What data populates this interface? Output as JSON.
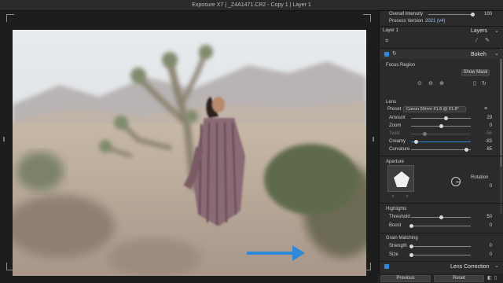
{
  "window": {
    "title": "Exposure X7 | _Z4A1471.CR2 - Copy 1 | Layer 1"
  },
  "panel": {
    "top": {
      "overall_intensity_label": "Overall Intensity",
      "overall_intensity_value": "100",
      "overall_intensity_level": 1.0,
      "process_version_label": "Process Version",
      "process_version_value": "2021 (v4)"
    },
    "layer_label": "Layer 1",
    "layers_label": "Layers",
    "bokeh": {
      "title": "Bokeh",
      "focus_region_label": "Focus Region",
      "show_mask_label": "Show Mask",
      "lens_label": "Lens",
      "preset_label": "Preset:",
      "preset_value": "Canon 50mm f/1.8 @ f/1.8*",
      "sliders": [
        {
          "label": "Amount",
          "value": "29",
          "level": 0.58,
          "dim": false
        },
        {
          "label": "Zoom",
          "value": "0",
          "level": 0.5,
          "dim": false
        },
        {
          "label": "Twist",
          "value": "-56",
          "level": 0.22,
          "dim": true
        },
        {
          "label": "Creamy",
          "value": "-83",
          "level": 0.08,
          "dim": false,
          "accent": true
        },
        {
          "label": "Curvature",
          "value": "85",
          "level": 0.92,
          "dim": false
        }
      ],
      "aperture_label": "Aperture",
      "rotation_label": "Rotation",
      "rotation_value": "0",
      "highlights_label": "Highlights",
      "highlight_sliders": [
        {
          "label": "Threshold",
          "value": "50",
          "level": 0.5
        },
        {
          "label": "Boost",
          "value": "0",
          "level": 0.0
        }
      ],
      "grain_label": "Grain Matching",
      "grain_sliders": [
        {
          "label": "Strength",
          "value": "0",
          "level": 0.0
        },
        {
          "label": "Size",
          "value": "0",
          "level": 0.0
        }
      ]
    },
    "lens_correction_label": "Lens Correction",
    "previous_label": "Previous",
    "reset_label": "Reset"
  },
  "colors": {
    "accent": "#2e8ad8",
    "panel_bg": "#2b2b2c",
    "app_bg": "#1c1c1d"
  },
  "icons": [
    "crop-icon",
    "brush-icon",
    "eyedropper-icon",
    "refresh-icon",
    "trash-icon",
    "arrow-icon"
  ]
}
